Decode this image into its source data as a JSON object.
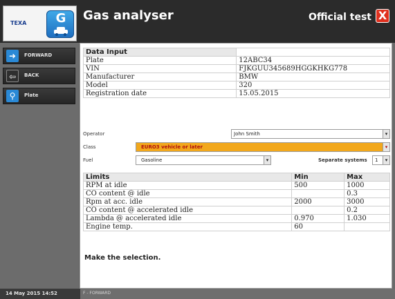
{
  "header": {
    "logo_text": "TEXA",
    "app_icon_letter": "G",
    "title": "Gas analyser",
    "mode": "Official test",
    "close_symbol": "X"
  },
  "sidebar": {
    "items": [
      {
        "label": "FORWARD",
        "icon": "arrow-right-icon",
        "glyph": "➜"
      },
      {
        "label": "BACK",
        "icon": "arrow-left-icon",
        "glyph": "⇦"
      },
      {
        "label": "Plate",
        "icon": "search-icon",
        "glyph": "⚲"
      }
    ]
  },
  "data_input": {
    "title": "Data Input",
    "rows": [
      {
        "label": "Plate",
        "value": "12ABC34"
      },
      {
        "label": "VIN",
        "value": "FJKGUU345689HGGKHKG778"
      },
      {
        "label": "Manufacturer",
        "value": "BMW"
      },
      {
        "label": "Model",
        "value": "320"
      },
      {
        "label": "Registration date",
        "value": "15.05.2015"
      }
    ]
  },
  "form": {
    "operator_label": "Operator",
    "operator_value": "John Smith",
    "class_label": "Class",
    "class_value": "EURO3 vehicle or later",
    "fuel_label": "Fuel",
    "fuel_value": "Gasoline",
    "separate_label": "Separate systems",
    "separate_value": "1",
    "highlight_color": "#f2a81c"
  },
  "limits": {
    "headers": [
      "Limits",
      "Min",
      "Max"
    ],
    "rows": [
      {
        "name": "RPM at idle",
        "min": "500",
        "max": "1000"
      },
      {
        "name": "CO content @ idle",
        "min": "",
        "max": "0.3"
      },
      {
        "name": "Rpm at acc. idle",
        "min": "2000",
        "max": "3000"
      },
      {
        "name": "CO content @ accelerated idle",
        "min": "",
        "max": "0.2"
      },
      {
        "name": "Lambda @ accelerated idle",
        "min": "0.970",
        "max": "1.030"
      },
      {
        "name": "Engine temp.",
        "min": "60",
        "max": ""
      }
    ]
  },
  "message": "Make the selection.",
  "status": {
    "datetime": "14 May 2015 14:52",
    "hint": "F - FORWARD"
  }
}
